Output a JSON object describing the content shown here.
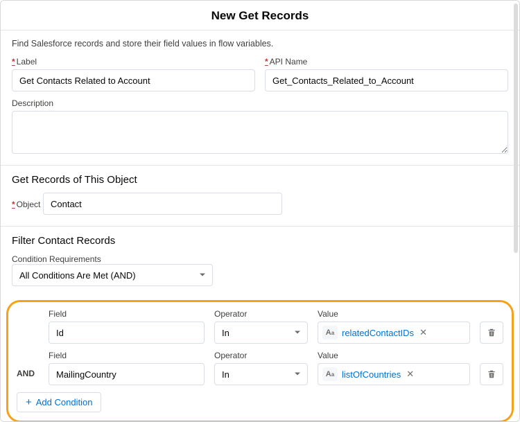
{
  "title": "New Get Records",
  "helper": "Find Salesforce records and store their field values in flow variables.",
  "labels": {
    "label": "Label",
    "api_name": "API Name",
    "description": "Description",
    "object_section": "Get Records of This Object",
    "object": "Object",
    "filter_section": "Filter Contact Records",
    "cond_req": "Condition Requirements",
    "field": "Field",
    "operator": "Operator",
    "value": "Value",
    "and": "AND"
  },
  "values": {
    "label": "Get Contacts Related to Account",
    "api_name": "Get_Contacts_Related_to_Account",
    "description": "",
    "object": "Contact",
    "cond_req": "All Conditions Are Met (AND)"
  },
  "conditions": [
    {
      "field": "Id",
      "operator": "In",
      "value": "relatedContactIDs"
    },
    {
      "field": "MailingCountry",
      "operator": "In",
      "value": "listOfCountries"
    }
  ],
  "buttons": {
    "add_condition": "Add Condition"
  }
}
